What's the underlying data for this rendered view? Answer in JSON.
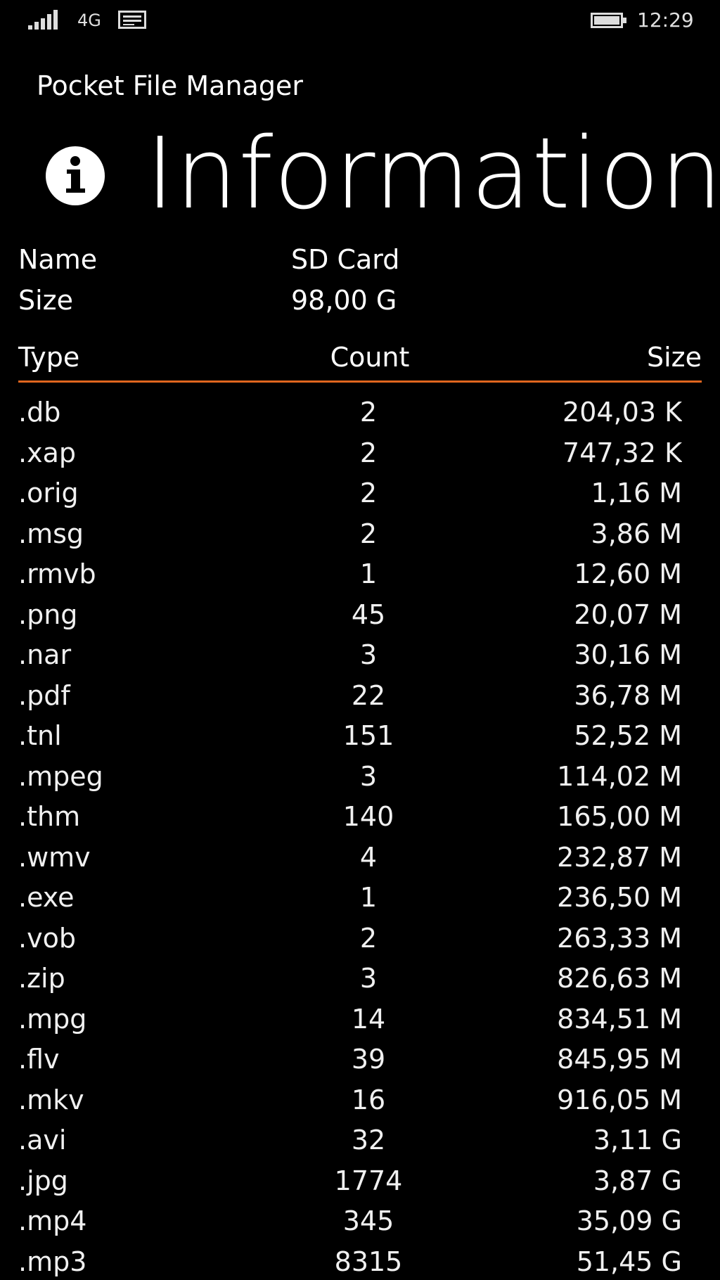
{
  "status_bar": {
    "network": "4G",
    "time": "12:29"
  },
  "header": {
    "app_title": "Pocket File Manager",
    "page_title": "Information",
    "icon": "info-icon"
  },
  "info": {
    "name_label": "Name",
    "name_value": "SD Card",
    "size_label": "Size",
    "size_value": "98,00 G"
  },
  "table": {
    "columns": {
      "type": "Type",
      "count": "Count",
      "size": "Size"
    },
    "accent_color": "#e0661f",
    "rows": [
      {
        "type": ".db",
        "count": "2",
        "size": "204,03 K"
      },
      {
        "type": ".xap",
        "count": "2",
        "size": "747,32 K"
      },
      {
        "type": ".orig",
        "count": "2",
        "size": "1,16 M"
      },
      {
        "type": ".msg",
        "count": "2",
        "size": "3,86 M"
      },
      {
        "type": ".rmvb",
        "count": "1",
        "size": "12,60 M"
      },
      {
        "type": ".png",
        "count": "45",
        "size": "20,07 M"
      },
      {
        "type": ".nar",
        "count": "3",
        "size": "30,16 M"
      },
      {
        "type": ".pdf",
        "count": "22",
        "size": "36,78 M"
      },
      {
        "type": ".tnl",
        "count": "151",
        "size": "52,52 M"
      },
      {
        "type": ".mpeg",
        "count": "3",
        "size": "114,02 M"
      },
      {
        "type": ".thm",
        "count": "140",
        "size": "165,00 M"
      },
      {
        "type": ".wmv",
        "count": "4",
        "size": "232,87 M"
      },
      {
        "type": ".exe",
        "count": "1",
        "size": "236,50 M"
      },
      {
        "type": ".vob",
        "count": "2",
        "size": "263,33 M"
      },
      {
        "type": ".zip",
        "count": "3",
        "size": "826,63 M"
      },
      {
        "type": ".mpg",
        "count": "14",
        "size": "834,51 M"
      },
      {
        "type": ".flv",
        "count": "39",
        "size": "845,95 M"
      },
      {
        "type": ".mkv",
        "count": "16",
        "size": "916,05 M"
      },
      {
        "type": ".avi",
        "count": "32",
        "size": "3,11 G"
      },
      {
        "type": ".jpg",
        "count": "1774",
        "size": "3,87 G"
      },
      {
        "type": ".mp4",
        "count": "345",
        "size": "35,09 G"
      },
      {
        "type": ".mp3",
        "count": "8315",
        "size": "51,45 G"
      }
    ]
  }
}
